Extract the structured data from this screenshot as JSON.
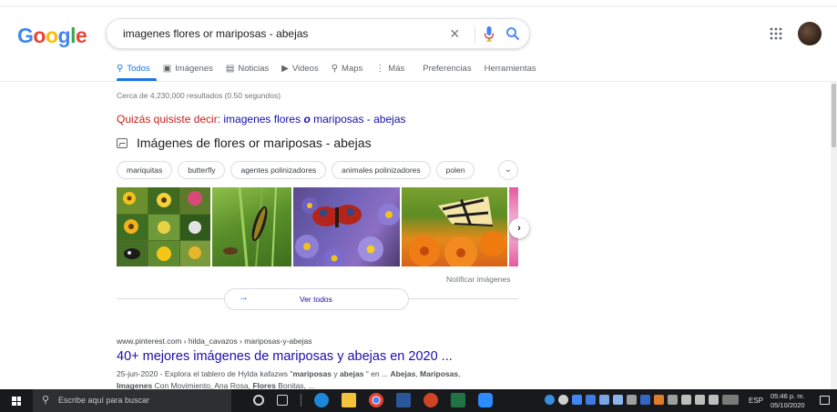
{
  "logo": "Google",
  "search": {
    "query": "imagenes flores or mariposas - abejas",
    "clear_label": "×"
  },
  "colors": {
    "google_blue": "#4285f4",
    "google_red": "#ea4335",
    "google_yellow": "#fbbc05",
    "google_green": "#34a853",
    "link": "#1a0dab",
    "accent": "#1a73e8",
    "taskbar": "#17191d"
  },
  "tabs": [
    {
      "label": "Todos",
      "icon": "search-icon",
      "glyph": "⚲",
      "active": true
    },
    {
      "label": "Imágenes",
      "icon": "image-icon",
      "glyph": "▣",
      "active": false
    },
    {
      "label": "Noticias",
      "icon": "news-icon",
      "glyph": "▤",
      "active": false
    },
    {
      "label": "Videos",
      "icon": "play-icon",
      "glyph": "▶",
      "active": false
    },
    {
      "label": "Maps",
      "icon": "map-pin-icon",
      "glyph": "⚲",
      "active": false
    },
    {
      "label": "Más",
      "icon": "more-vert-icon",
      "glyph": "⋮",
      "active": false
    },
    {
      "label": "Preferencias",
      "icon": "",
      "glyph": "",
      "active": false
    },
    {
      "label": "Herramientas",
      "icon": "",
      "glyph": "",
      "active": false
    }
  ],
  "result_stats": "Cerca de 4,230,000 resultados (0.50 segundos)",
  "spelling": {
    "prefix": "Quizás quisiste decir:",
    "pre": "imagenes flores ",
    "bold": "o",
    "post": " mariposas - abejas"
  },
  "image_pack": {
    "title": "Imágenes de flores or mariposas - abejas",
    "chips": [
      "mariquitas",
      "butterfly",
      "agentes polinizadores",
      "animales polinizadores",
      "polen"
    ],
    "expand_glyph": "⌄",
    "next_glyph": "›",
    "notify": "Notificar imágenes",
    "see_all": "Ver todos",
    "see_all_arrow": "→"
  },
  "result": {
    "url": "www.pinterest.com › hilda_cavazos › mariposas-y-abejas",
    "title": "40+ mejores imágenes de mariposas y abejas en 2020 ...",
    "snippet_parts": [
      {
        "t": "25-jun-2020 - Explora el tablero de Hylda kafazws \"",
        "b": false
      },
      {
        "t": "mariposas",
        "b": true
      },
      {
        "t": " y ",
        "b": false
      },
      {
        "t": "abejas",
        "b": true
      },
      {
        "t": " \" en ... ",
        "b": false
      },
      {
        "t": "Abejas",
        "b": true
      },
      {
        "t": ", ",
        "b": false
      },
      {
        "t": "Mariposas",
        "b": true
      },
      {
        "t": ", ",
        "b": false
      },
      {
        "t": "Imagenes",
        "b": true
      },
      {
        "t": " Con Movimiento, Ana Rosa, ",
        "b": false
      },
      {
        "t": "Flores",
        "b": true
      },
      {
        "t": " Bonitas, ...",
        "b": false
      }
    ]
  },
  "taskbar": {
    "search_placeholder": "Escribe aquí para buscar",
    "lang": "ESP",
    "time": "05:46 p. m.",
    "date": "05/10/2020"
  }
}
